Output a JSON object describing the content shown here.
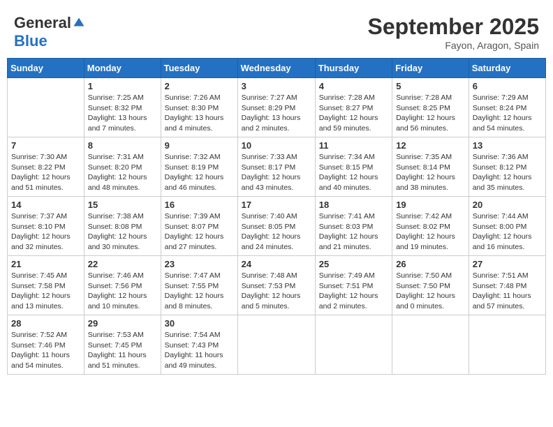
{
  "logo": {
    "general": "General",
    "blue": "Blue"
  },
  "header": {
    "month": "September 2025",
    "location": "Fayon, Aragon, Spain"
  },
  "days_of_week": [
    "Sunday",
    "Monday",
    "Tuesday",
    "Wednesday",
    "Thursday",
    "Friday",
    "Saturday"
  ],
  "weeks": [
    [
      {
        "day": "",
        "info": ""
      },
      {
        "day": "1",
        "info": "Sunrise: 7:25 AM\nSunset: 8:32 PM\nDaylight: 13 hours\nand 7 minutes."
      },
      {
        "day": "2",
        "info": "Sunrise: 7:26 AM\nSunset: 8:30 PM\nDaylight: 13 hours\nand 4 minutes."
      },
      {
        "day": "3",
        "info": "Sunrise: 7:27 AM\nSunset: 8:29 PM\nDaylight: 13 hours\nand 2 minutes."
      },
      {
        "day": "4",
        "info": "Sunrise: 7:28 AM\nSunset: 8:27 PM\nDaylight: 12 hours\nand 59 minutes."
      },
      {
        "day": "5",
        "info": "Sunrise: 7:28 AM\nSunset: 8:25 PM\nDaylight: 12 hours\nand 56 minutes."
      },
      {
        "day": "6",
        "info": "Sunrise: 7:29 AM\nSunset: 8:24 PM\nDaylight: 12 hours\nand 54 minutes."
      }
    ],
    [
      {
        "day": "7",
        "info": "Sunrise: 7:30 AM\nSunset: 8:22 PM\nDaylight: 12 hours\nand 51 minutes."
      },
      {
        "day": "8",
        "info": "Sunrise: 7:31 AM\nSunset: 8:20 PM\nDaylight: 12 hours\nand 48 minutes."
      },
      {
        "day": "9",
        "info": "Sunrise: 7:32 AM\nSunset: 8:19 PM\nDaylight: 12 hours\nand 46 minutes."
      },
      {
        "day": "10",
        "info": "Sunrise: 7:33 AM\nSunset: 8:17 PM\nDaylight: 12 hours\nand 43 minutes."
      },
      {
        "day": "11",
        "info": "Sunrise: 7:34 AM\nSunset: 8:15 PM\nDaylight: 12 hours\nand 40 minutes."
      },
      {
        "day": "12",
        "info": "Sunrise: 7:35 AM\nSunset: 8:14 PM\nDaylight: 12 hours\nand 38 minutes."
      },
      {
        "day": "13",
        "info": "Sunrise: 7:36 AM\nSunset: 8:12 PM\nDaylight: 12 hours\nand 35 minutes."
      }
    ],
    [
      {
        "day": "14",
        "info": "Sunrise: 7:37 AM\nSunset: 8:10 PM\nDaylight: 12 hours\nand 32 minutes."
      },
      {
        "day": "15",
        "info": "Sunrise: 7:38 AM\nSunset: 8:08 PM\nDaylight: 12 hours\nand 30 minutes."
      },
      {
        "day": "16",
        "info": "Sunrise: 7:39 AM\nSunset: 8:07 PM\nDaylight: 12 hours\nand 27 minutes."
      },
      {
        "day": "17",
        "info": "Sunrise: 7:40 AM\nSunset: 8:05 PM\nDaylight: 12 hours\nand 24 minutes."
      },
      {
        "day": "18",
        "info": "Sunrise: 7:41 AM\nSunset: 8:03 PM\nDaylight: 12 hours\nand 21 minutes."
      },
      {
        "day": "19",
        "info": "Sunrise: 7:42 AM\nSunset: 8:02 PM\nDaylight: 12 hours\nand 19 minutes."
      },
      {
        "day": "20",
        "info": "Sunrise: 7:44 AM\nSunset: 8:00 PM\nDaylight: 12 hours\nand 16 minutes."
      }
    ],
    [
      {
        "day": "21",
        "info": "Sunrise: 7:45 AM\nSunset: 7:58 PM\nDaylight: 12 hours\nand 13 minutes."
      },
      {
        "day": "22",
        "info": "Sunrise: 7:46 AM\nSunset: 7:56 PM\nDaylight: 12 hours\nand 10 minutes."
      },
      {
        "day": "23",
        "info": "Sunrise: 7:47 AM\nSunset: 7:55 PM\nDaylight: 12 hours\nand 8 minutes."
      },
      {
        "day": "24",
        "info": "Sunrise: 7:48 AM\nSunset: 7:53 PM\nDaylight: 12 hours\nand 5 minutes."
      },
      {
        "day": "25",
        "info": "Sunrise: 7:49 AM\nSunset: 7:51 PM\nDaylight: 12 hours\nand 2 minutes."
      },
      {
        "day": "26",
        "info": "Sunrise: 7:50 AM\nSunset: 7:50 PM\nDaylight: 12 hours\nand 0 minutes."
      },
      {
        "day": "27",
        "info": "Sunrise: 7:51 AM\nSunset: 7:48 PM\nDaylight: 11 hours\nand 57 minutes."
      }
    ],
    [
      {
        "day": "28",
        "info": "Sunrise: 7:52 AM\nSunset: 7:46 PM\nDaylight: 11 hours\nand 54 minutes."
      },
      {
        "day": "29",
        "info": "Sunrise: 7:53 AM\nSunset: 7:45 PM\nDaylight: 11 hours\nand 51 minutes."
      },
      {
        "day": "30",
        "info": "Sunrise: 7:54 AM\nSunset: 7:43 PM\nDaylight: 11 hours\nand 49 minutes."
      },
      {
        "day": "",
        "info": ""
      },
      {
        "day": "",
        "info": ""
      },
      {
        "day": "",
        "info": ""
      },
      {
        "day": "",
        "info": ""
      }
    ]
  ]
}
